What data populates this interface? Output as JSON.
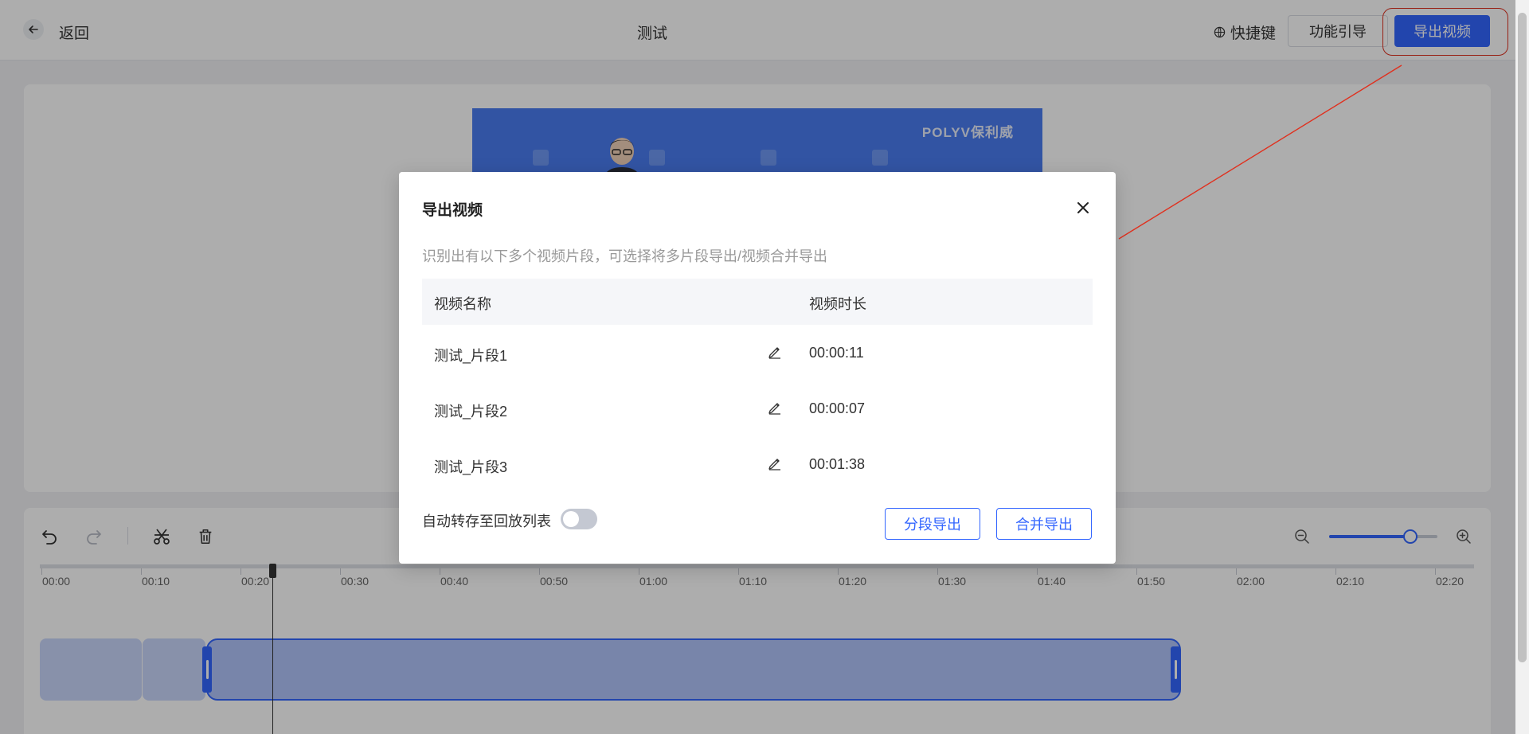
{
  "header": {
    "back_label": "返回",
    "title": "测试",
    "shortcut_label": "快捷键",
    "guide_label": "功能引导",
    "export_label": "导出视频"
  },
  "preview": {
    "logo_text": "POLYV保利威"
  },
  "timeline": {
    "ticks": [
      "00:00",
      "00:10",
      "00:20",
      "00:30",
      "00:40",
      "00:50",
      "01:00",
      "01:10",
      "01:20",
      "01:30",
      "01:40",
      "01:50",
      "02:00",
      "02:10",
      "02:20"
    ]
  },
  "modal": {
    "title": "导出视频",
    "description": "识别出有以下多个视频片段，可选择将多片段导出/视频合并导出",
    "columns": {
      "name": "视频名称",
      "duration": "视频时长"
    },
    "rows": [
      {
        "name": "测试_片段1",
        "duration": "00:00:11"
      },
      {
        "name": "测试_片段2",
        "duration": "00:00:07"
      },
      {
        "name": "测试_片段3",
        "duration": "00:01:38"
      }
    ],
    "auto_save_label": "自动转存至回放列表",
    "auto_save_on": false,
    "segment_export_label": "分段导出",
    "merge_export_label": "合并导出"
  },
  "colors": {
    "accent": "#3366ff",
    "annotation": "#e0301e"
  }
}
